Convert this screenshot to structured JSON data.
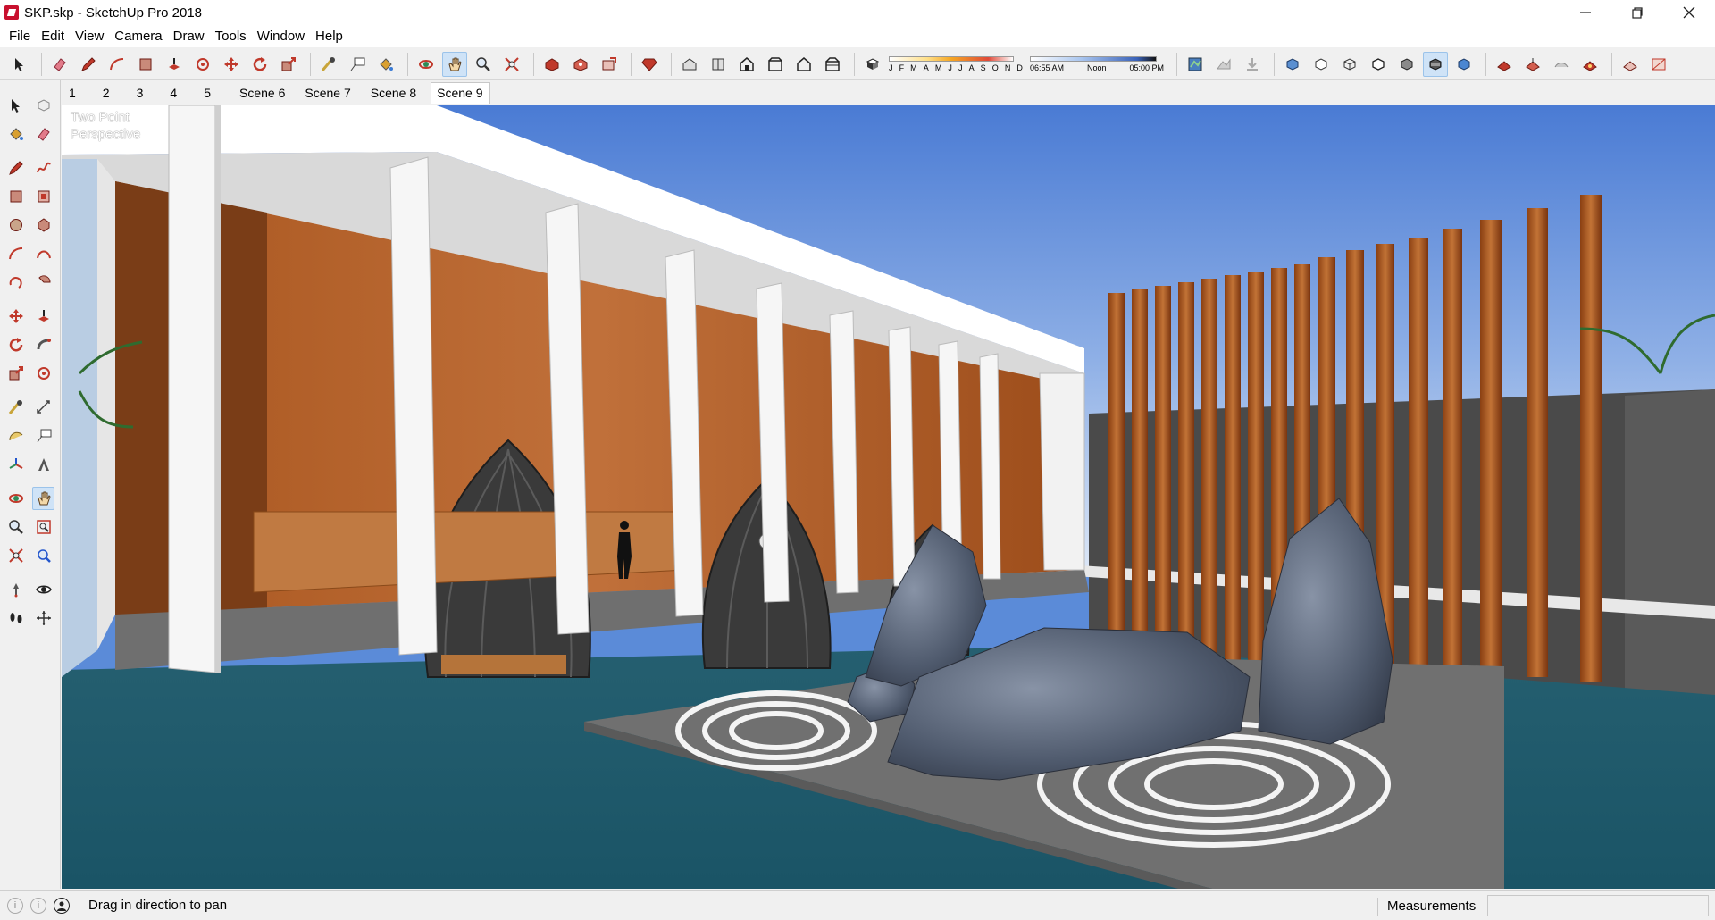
{
  "window": {
    "title": "SKP.skp - SketchUp Pro 2018",
    "controls": [
      "minimize-icon",
      "maximize-icon",
      "close-icon"
    ]
  },
  "menu": {
    "file": "File",
    "edit": "Edit",
    "view": "View",
    "camera": "Camera",
    "draw": "Draw",
    "tools": "Tools",
    "window": "Window",
    "help": "Help"
  },
  "shadow_settings": {
    "months": [
      "J",
      "F",
      "M",
      "A",
      "M",
      "J",
      "J",
      "A",
      "S",
      "O",
      "N",
      "D"
    ],
    "time_start": "06:55 AM",
    "time_mid": "Noon",
    "time_end": "05:00 PM"
  },
  "scenes": {
    "tabs": [
      "1",
      "2",
      "3",
      "4",
      "5",
      "Scene 6",
      "Scene 7",
      "Scene 8",
      "Scene 9"
    ],
    "active": "Scene 9"
  },
  "viewport": {
    "perspective_line1": "Two Point",
    "perspective_line2": "Perspective",
    "colors": {
      "sky_top": "#4d7fd6",
      "sky_bottom": "#c8d9f2",
      "water": "#1d5e73",
      "wood": "#b5622a",
      "column": "#f4f4f4",
      "rock": "#5b6577",
      "gravel": "#6e6e6e"
    }
  },
  "status": {
    "hint": "Drag in direction to pan",
    "measurements_label": "Measurements",
    "measurements_value": ""
  },
  "accent": {
    "active_tool_bg": "#cfe3f7",
    "tool_red": "#c0392b"
  }
}
